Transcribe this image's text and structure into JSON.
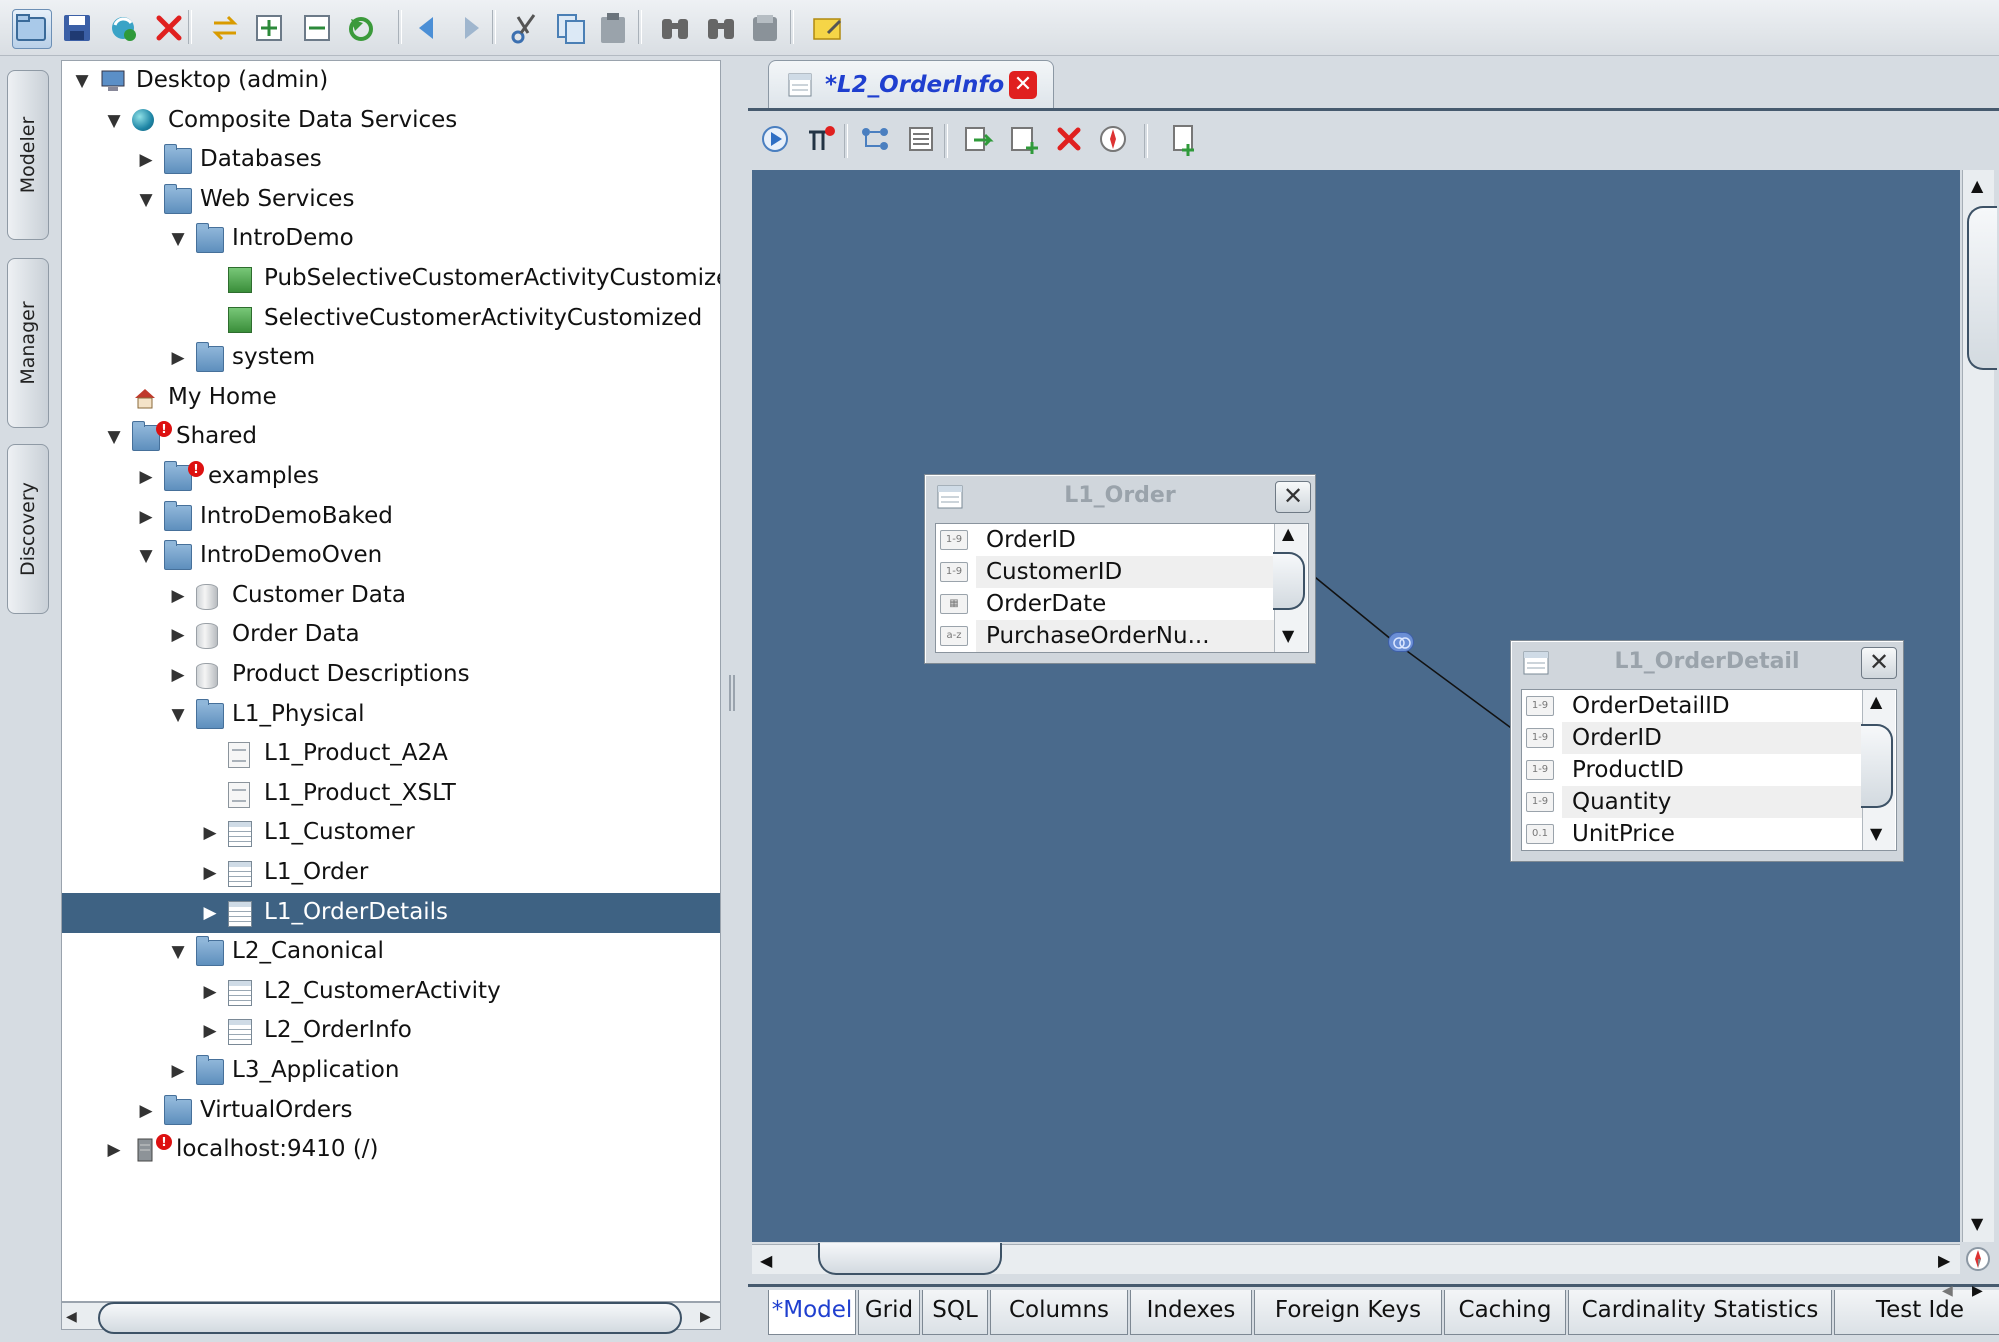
{
  "toolbar": {
    "icons": [
      "open-icon",
      "save-icon",
      "refresh-icon",
      "delete-icon",
      "sync-icon",
      "expand-all-icon",
      "collapse-all-icon",
      "revert-icon",
      "back-icon",
      "forward-icon",
      "cut-icon",
      "copy-icon",
      "paste-icon",
      "find-icon",
      "find-next-icon",
      "print-icon",
      "new-note-icon"
    ]
  },
  "side_tabs": {
    "modeler": "Modeler",
    "manager": "Manager",
    "discovery": "Discovery"
  },
  "tree": {
    "items": [
      {
        "label": "Desktop (admin)",
        "depth": 0,
        "state": "open",
        "icon": "computer-icon"
      },
      {
        "label": "Composite Data Services",
        "depth": 1,
        "state": "open",
        "icon": "globe-icon"
      },
      {
        "label": "Databases",
        "depth": 2,
        "state": "closed",
        "icon": "folder-globe-icon"
      },
      {
        "label": "Web Services",
        "depth": 2,
        "state": "open",
        "icon": "folder-globe-icon"
      },
      {
        "label": "IntroDemo",
        "depth": 3,
        "state": "open",
        "icon": "service-icon"
      },
      {
        "label": "PubSelectiveCustomerActivityCustomized",
        "depth": 4,
        "state": "none",
        "icon": "webservice-icon"
      },
      {
        "label": "SelectiveCustomerActivityCustomized",
        "depth": 4,
        "state": "none",
        "icon": "webservice-icon"
      },
      {
        "label": "system",
        "depth": 3,
        "state": "closed",
        "icon": "folder-globe-icon"
      },
      {
        "label": "My Home",
        "depth": 1,
        "state": "none",
        "icon": "home-icon"
      },
      {
        "label": "Shared",
        "depth": 1,
        "state": "open",
        "icon": "shared-folder-icon",
        "error": true
      },
      {
        "label": "examples",
        "depth": 2,
        "state": "closed",
        "icon": "folder-icon",
        "error": true
      },
      {
        "label": "IntroDemoBaked",
        "depth": 2,
        "state": "closed",
        "icon": "folder-icon"
      },
      {
        "label": "IntroDemoOven",
        "depth": 2,
        "state": "open",
        "icon": "folder-icon"
      },
      {
        "label": "Customer Data",
        "depth": 3,
        "state": "closed",
        "icon": "datasource-icon"
      },
      {
        "label": "Order Data",
        "depth": 3,
        "state": "closed",
        "icon": "datasource-icon"
      },
      {
        "label": "Product Descriptions",
        "depth": 3,
        "state": "closed",
        "icon": "datasource-icon"
      },
      {
        "label": "L1_Physical",
        "depth": 3,
        "state": "open",
        "icon": "folder-icon"
      },
      {
        "label": "L1_Product_A2A",
        "depth": 4,
        "state": "none",
        "icon": "document-icon"
      },
      {
        "label": "L1_Product_XSLT",
        "depth": 4,
        "state": "none",
        "icon": "document-icon"
      },
      {
        "label": "L1_Customer",
        "depth": 4,
        "state": "closed",
        "icon": "view-icon"
      },
      {
        "label": "L1_Order",
        "depth": 4,
        "state": "closed",
        "icon": "view-icon"
      },
      {
        "label": "L1_OrderDetails",
        "depth": 4,
        "state": "closed",
        "icon": "view-icon",
        "selected": true
      },
      {
        "label": "L2_Canonical",
        "depth": 3,
        "state": "open",
        "icon": "folder-icon"
      },
      {
        "label": "L2_CustomerActivity",
        "depth": 4,
        "state": "closed",
        "icon": "view-icon"
      },
      {
        "label": "L2_OrderInfo",
        "depth": 4,
        "state": "closed",
        "icon": "view-icon"
      },
      {
        "label": "L3_Application",
        "depth": 3,
        "state": "closed",
        "icon": "folder-icon"
      },
      {
        "label": "VirtualOrders",
        "depth": 2,
        "state": "closed",
        "icon": "folder-icon"
      },
      {
        "label": "localhost:9410 (/)",
        "depth": 1,
        "state": "closed",
        "icon": "server-icon",
        "error": true
      }
    ]
  },
  "editor": {
    "tab_title": "*L2_OrderInfo",
    "toolbar_icons": [
      "execute-icon",
      "add-table-icon",
      "join-icon",
      "properties-icon",
      "export-icon",
      "add-column-icon",
      "remove-icon",
      "navigate-icon",
      "new-view-icon"
    ]
  },
  "tables": {
    "l1_order": {
      "title": "L1_Order",
      "columns": [
        {
          "name": "OrderID",
          "type": "1-9"
        },
        {
          "name": "CustomerID",
          "type": "1-9"
        },
        {
          "name": "OrderDate",
          "type": "date"
        },
        {
          "name": "PurchaseOrderNu...",
          "type": "a-z"
        }
      ]
    },
    "l1_orderdetail": {
      "title": "L1_OrderDetail",
      "columns": [
        {
          "name": "OrderDetailID",
          "type": "1-9"
        },
        {
          "name": "OrderID",
          "type": "1-9"
        },
        {
          "name": "ProductID",
          "type": "1-9"
        },
        {
          "name": "Quantity",
          "type": "1-9"
        },
        {
          "name": "UnitPrice",
          "type": "0.1"
        }
      ]
    }
  },
  "bottom_tabs": [
    "*Model",
    "Grid",
    "SQL",
    "Columns",
    "Indexes",
    "Foreign Keys",
    "Caching",
    "Cardinality Statistics",
    "Test Ide"
  ],
  "colors": {
    "canvas": "#4a6a8c",
    "selection": "#3e6283",
    "tab_title": "#1f3fcf",
    "delete_red": "#e0201f"
  }
}
